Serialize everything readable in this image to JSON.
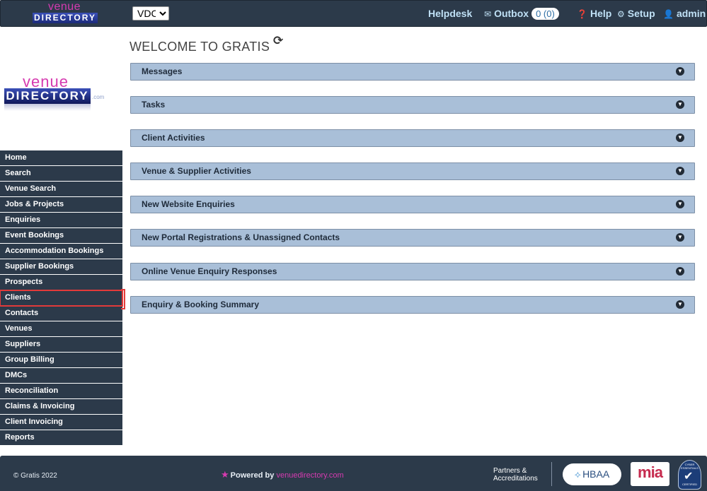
{
  "header": {
    "logo_top": "venue",
    "logo_bottom": "DIRECTORY",
    "company_selected": "VDC",
    "helpdesk": "Helpdesk",
    "outbox": "Outbox",
    "outbox_count": "0 (0)",
    "help": "Help",
    "setup": "Setup",
    "user": "admin"
  },
  "side_logo": {
    "top": "venue",
    "bottom": "DIRECTORY",
    "suffix": ".com"
  },
  "sidebar": {
    "items": [
      {
        "label": "Home"
      },
      {
        "label": "Search"
      },
      {
        "label": "Venue Search"
      },
      {
        "label": "Jobs & Projects"
      },
      {
        "label": "Enquiries"
      },
      {
        "label": "Event Bookings"
      },
      {
        "label": "Accommodation Bookings"
      },
      {
        "label": "Supplier Bookings"
      },
      {
        "label": "Prospects"
      },
      {
        "label": "Clients"
      },
      {
        "label": "Contacts"
      },
      {
        "label": "Venues"
      },
      {
        "label": "Suppliers"
      },
      {
        "label": "Group Billing"
      },
      {
        "label": "DMCs"
      },
      {
        "label": "Reconciliation"
      },
      {
        "label": "Claims & Invoicing"
      },
      {
        "label": "Client Invoicing"
      },
      {
        "label": "Reports"
      }
    ],
    "selected": "Clients"
  },
  "main": {
    "title": "WELCOME TO GRATIS",
    "panels": [
      {
        "label": "Messages"
      },
      {
        "label": "Tasks"
      },
      {
        "label": "Client Activities"
      },
      {
        "label": "Venue & Supplier Activities"
      },
      {
        "label": "New Website Enquiries"
      },
      {
        "label": "New Portal Registrations & Unassigned Contacts"
      },
      {
        "label": "Online Venue Enquiry Responses"
      },
      {
        "label": "Enquiry & Booking Summary"
      }
    ]
  },
  "footer": {
    "copyright": "© Gratis 2022",
    "powered_by": "Powered by",
    "powered_brand": "venuedirectory.com",
    "partners_line1": "Partners &",
    "partners_line2": "Accreditations",
    "hbaa": "HBAA",
    "mia": "mia",
    "cyber_top": "CYBER ESSENTIALS",
    "cyber_bottom": "CERTIFIED"
  },
  "colors": {
    "topbar": "#2c3a4a",
    "panel": "#a9bfd8",
    "selected_outline": "#e23a3a",
    "brand_pink": "#d63ab0"
  }
}
